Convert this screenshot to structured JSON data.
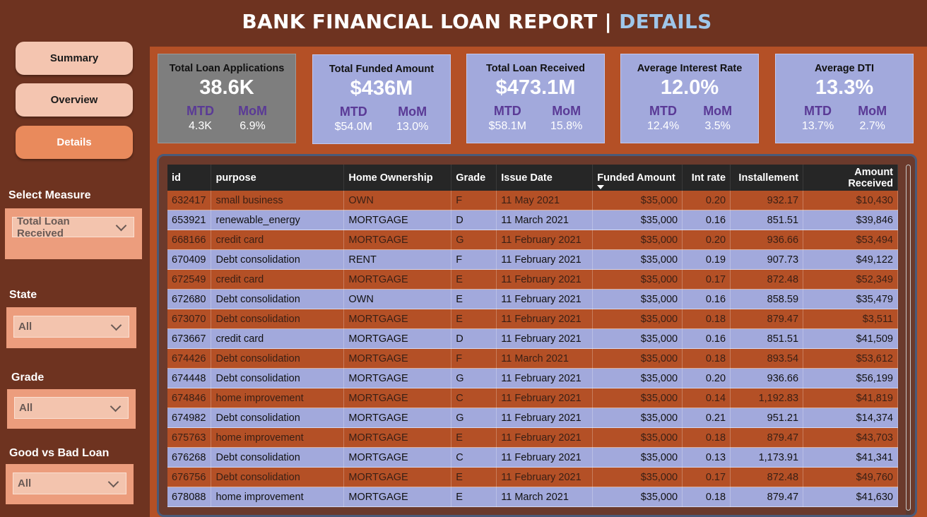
{
  "header": {
    "title_main": "BANK FINANCIAL LOAN REPORT | ",
    "title_accent": "DETAILS"
  },
  "nav": {
    "summary": "Summary",
    "overview": "Overview",
    "details": "Details"
  },
  "filters": {
    "measure": {
      "label": "Select Measure",
      "value": "Total Loan Received"
    },
    "state": {
      "label": "State",
      "value": "All"
    },
    "grade": {
      "label": "Grade",
      "value": "All"
    },
    "loan": {
      "label": "Good vs Bad Loan",
      "value": "All"
    }
  },
  "kpis": [
    {
      "title": "Total Loan Applications",
      "value": "38.6K",
      "mtd_label": "MTD",
      "mtd": "4.3K",
      "mom_label": "MoM",
      "mom": "6.9%"
    },
    {
      "title": "Total Funded Amount",
      "value": "$436M",
      "mtd_label": "MTD",
      "mtd": "$54.0M",
      "mom_label": "MoM",
      "mom": "13.0%"
    },
    {
      "title": "Total Loan Received",
      "value": "$473.1M",
      "mtd_label": "MTD",
      "mtd": "$58.1M",
      "mom_label": "MoM",
      "mom": "15.8%"
    },
    {
      "title": "Average Interest Rate",
      "value": "12.0%",
      "mtd_label": "MTD",
      "mtd": "12.4%",
      "mom_label": "MoM",
      "mom": "3.5%"
    },
    {
      "title": "Average DTI",
      "value": "13.3%",
      "mtd_label": "MTD",
      "mtd": "13.7%",
      "mom_label": "MoM",
      "mom": "2.7%"
    }
  ],
  "table": {
    "columns": [
      "id",
      "purpose",
      "Home Ownership",
      "Grade",
      "Issue Date",
      "Funded Amount",
      "Int rate",
      "Installement",
      "Amount Received"
    ],
    "rows": [
      [
        "632417",
        "small business",
        "OWN",
        "F",
        "11 May 2021",
        "$35,000",
        "0.20",
        "932.17",
        "$10,430"
      ],
      [
        "653921",
        "renewable_energy",
        "MORTGAGE",
        "D",
        "11 March 2021",
        "$35,000",
        "0.16",
        "851.51",
        "$39,846"
      ],
      [
        "668166",
        "credit card",
        "MORTGAGE",
        "G",
        "11 February 2021",
        "$35,000",
        "0.20",
        "936.66",
        "$53,494"
      ],
      [
        "670409",
        "Debt consolidation",
        "RENT",
        "F",
        "11 February 2021",
        "$35,000",
        "0.19",
        "907.73",
        "$49,122"
      ],
      [
        "672549",
        "credit card",
        "MORTGAGE",
        "E",
        "11 February 2021",
        "$35,000",
        "0.17",
        "872.48",
        "$52,349"
      ],
      [
        "672680",
        "Debt consolidation",
        "OWN",
        "E",
        "11 February 2021",
        "$35,000",
        "0.16",
        "858.59",
        "$35,479"
      ],
      [
        "673070",
        "Debt consolidation",
        "MORTGAGE",
        "E",
        "11 February 2021",
        "$35,000",
        "0.18",
        "879.47",
        "$3,511"
      ],
      [
        "673667",
        "credit card",
        "MORTGAGE",
        "D",
        "11 February 2021",
        "$35,000",
        "0.16",
        "851.51",
        "$41,509"
      ],
      [
        "674426",
        "Debt consolidation",
        "MORTGAGE",
        "F",
        "11 March 2021",
        "$35,000",
        "0.18",
        "893.54",
        "$53,612"
      ],
      [
        "674448",
        "Debt consolidation",
        "MORTGAGE",
        "G",
        "11 February 2021",
        "$35,000",
        "0.20",
        "936.66",
        "$56,199"
      ],
      [
        "674846",
        "home improvement",
        "MORTGAGE",
        "C",
        "11 February 2021",
        "$35,000",
        "0.14",
        "1,192.83",
        "$41,819"
      ],
      [
        "674982",
        "Debt consolidation",
        "MORTGAGE",
        "G",
        "11 February 2021",
        "$35,000",
        "0.21",
        "951.21",
        "$14,374"
      ],
      [
        "675763",
        "home improvement",
        "MORTGAGE",
        "E",
        "11 February 2021",
        "$35,000",
        "0.18",
        "879.47",
        "$43,703"
      ],
      [
        "676268",
        "Debt consolidation",
        "MORTGAGE",
        "C",
        "11 February 2021",
        "$35,000",
        "0.13",
        "1,173.91",
        "$41,341"
      ],
      [
        "676756",
        "Debt consolidation",
        "MORTGAGE",
        "E",
        "11 February 2021",
        "$35,000",
        "0.17",
        "872.48",
        "$49,760"
      ],
      [
        "678088",
        "home improvement",
        "MORTGAGE",
        "E",
        "11 March 2021",
        "$35,000",
        "0.18",
        "879.47",
        "$41,630"
      ]
    ]
  }
}
